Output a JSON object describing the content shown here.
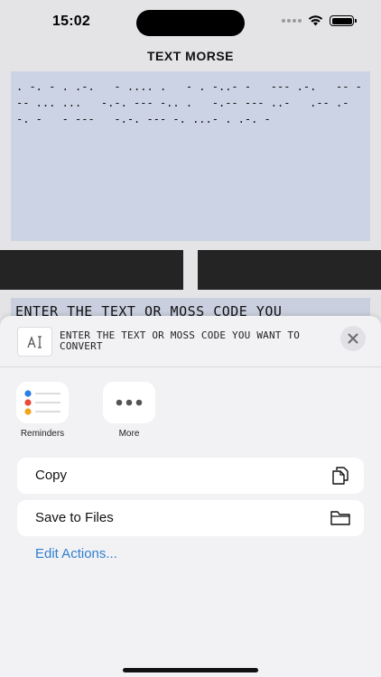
{
  "status": {
    "time": "15:02"
  },
  "app": {
    "title": "TEXT MORSE",
    "morse_output": ". -. - . .-.   - .... .   - . -..- -   --- .-.   -- --- ... ...   -.-. --- -.. .   -.-- --- ..-   .-- .- -. -   - ---   -.-. --- -. ...- . .-. -",
    "input_text": "ENTER THE TEXT OR MOSS CODE YOU"
  },
  "sheet": {
    "title": "ENTER THE TEXT OR MOSS CODE YOU WANT TO CONVERT",
    "apps": [
      {
        "label": "Reminders",
        "icon": "reminders-icon"
      },
      {
        "label": "More",
        "icon": "more-icon"
      }
    ],
    "actions": [
      {
        "label": "Copy",
        "icon": "copy-icon"
      },
      {
        "label": "Save to Files",
        "icon": "folder-icon"
      }
    ],
    "edit_actions": "Edit Actions..."
  },
  "colors": {
    "link": "#2f7fd0",
    "morse_bg": "#ccd3e4",
    "dark_button": "#242424"
  }
}
